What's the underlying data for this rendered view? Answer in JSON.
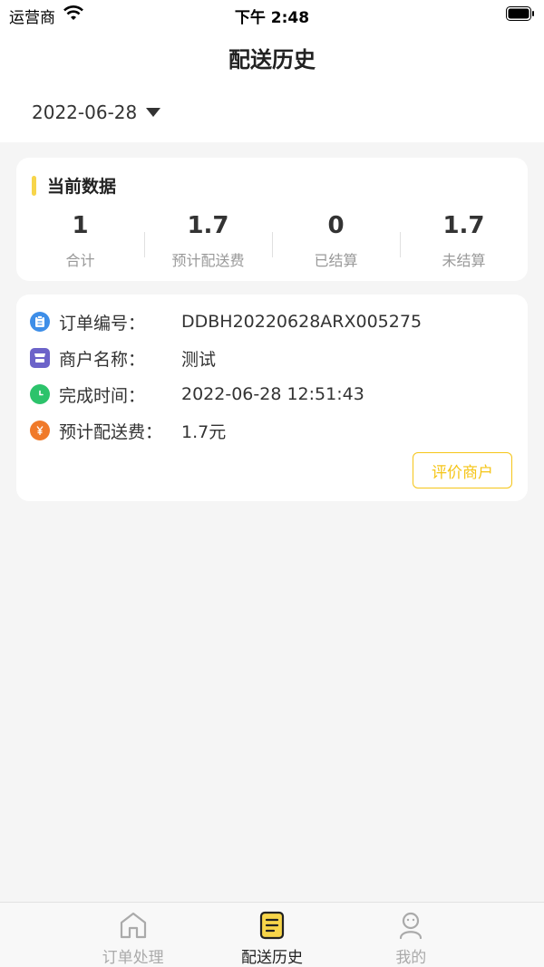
{
  "status_bar": {
    "carrier": "运营商",
    "time": "下午 2:48"
  },
  "nav": {
    "title": "配送历史"
  },
  "date_filter": {
    "value": "2022-06-28"
  },
  "summary": {
    "title": "当前数据",
    "accent_color": "#f7d54a",
    "stats": [
      {
        "value": "1",
        "label": "合计"
      },
      {
        "value": "1.7",
        "label": "预计配送费"
      },
      {
        "value": "0",
        "label": "已结算"
      },
      {
        "value": "1.7",
        "label": "未结算"
      }
    ]
  },
  "order": {
    "rows": [
      {
        "icon": "clipboard-icon",
        "icon_color": "#3d8ee8",
        "label": "订单编号：",
        "value": "DDBH20220628ARX005275"
      },
      {
        "icon": "store-icon",
        "icon_color": "#6c63c9",
        "label": "商户名称：",
        "value": "测试"
      },
      {
        "icon": "clock-icon",
        "icon_color": "#2cc36b",
        "label": "完成时间：",
        "value": "2022-06-28 12:51:43"
      },
      {
        "icon": "yen-icon",
        "icon_color": "#f07a2a",
        "label": "预计配送费：",
        "value": "1.7元"
      }
    ],
    "review_button": "评价商户",
    "button_color": "#f5c518"
  },
  "tabs": [
    {
      "icon": "home-icon",
      "label": "订单处理",
      "active": false
    },
    {
      "icon": "document-icon",
      "label": "配送历史",
      "active": true
    },
    {
      "icon": "user-icon",
      "label": "我的",
      "active": false
    }
  ]
}
